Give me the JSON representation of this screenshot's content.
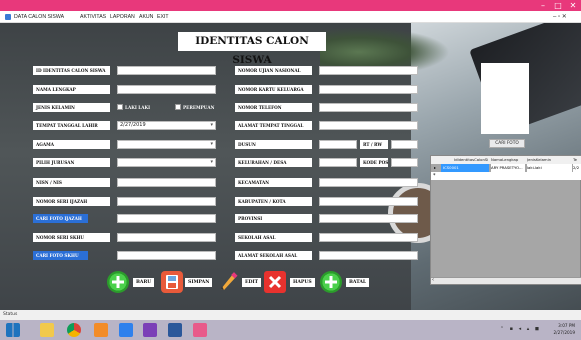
{
  "window": {
    "controls": {
      "minimize": "–",
      "maximize": "□",
      "close": "✕",
      "menu_restore": "– ▫ ✕"
    }
  },
  "menu": {
    "items": [
      "DATA CALON SISWA",
      "AKTIVITAS",
      "LAPORAN",
      "AKUN",
      "EXIT"
    ]
  },
  "form": {
    "title": "IDENTITAS CALON SISWA",
    "left": {
      "id_label": "ID IDENTITAS CALON SISWA",
      "nama_label": "NAMA LENGKAP",
      "jk_label": "JENIS KELAMIN",
      "laki_label": "LAKI LAKI",
      "perempuan_label": "PEREMPUAN",
      "ttl_label": "TEMPAT TANGGAL LAHIR",
      "ttl_date": "2/27/2019",
      "agama_label": "AGAMA",
      "jurusan_label": "PILIH JURUSAN",
      "nisn_label": "NISN / NIS",
      "ijazah_label": "NOMOR SERI IJAZAH",
      "cari_ijazah": "CARI FOTO IJAZAH",
      "skhu_label": "NOMOR SERI SKHU",
      "cari_skhu": "CARI FOTO SKHU"
    },
    "right": {
      "ujian_label": "NOMOR UJIAN NASIONAL",
      "kk_label": "NOMOR KARTU KELUARGA",
      "telepon_label": "NOMOR TELEFON",
      "alamat_label": "ALAMAT TEMPAT TINGGAL",
      "dusun_label": "DUSUN",
      "rtrw_label": "RT / RW",
      "kelurahan_label": "KELURAHAN / DESA",
      "kodepos_label": "KODE POS",
      "kecamatan_label": "KECAMATAN",
      "kabupaten_label": "KABUPATEN / KOTA",
      "provinsi_label": "PROVINSI",
      "sekolah_label": "SEKOLAH ASAL",
      "alamat_sekolah_label": "ALAMAT SEKOLAH ASAL"
    },
    "cari_foto": "CARI FOTO"
  },
  "grid": {
    "columns": [
      "IdIdentitasCalonSis",
      "NamaLengkap",
      "JenisKelamin",
      "Te"
    ],
    "row": [
      "ICS0001",
      "ARY PRASETYO...",
      "laki-laki",
      "2/2"
    ]
  },
  "buttons": {
    "baru": "BARU",
    "simpan": "SIMPAN",
    "edit": "EDIT",
    "hapus": "HAPUS",
    "batal": "BATAL"
  },
  "status": {
    "text": "Status"
  },
  "taskbar": {
    "time": "3:07 PM",
    "date": "2/27/2019"
  },
  "colors": {
    "titlebar": "#e8387b",
    "label_blue": "#2b6fd6",
    "grid_selected": "#3399ff"
  }
}
